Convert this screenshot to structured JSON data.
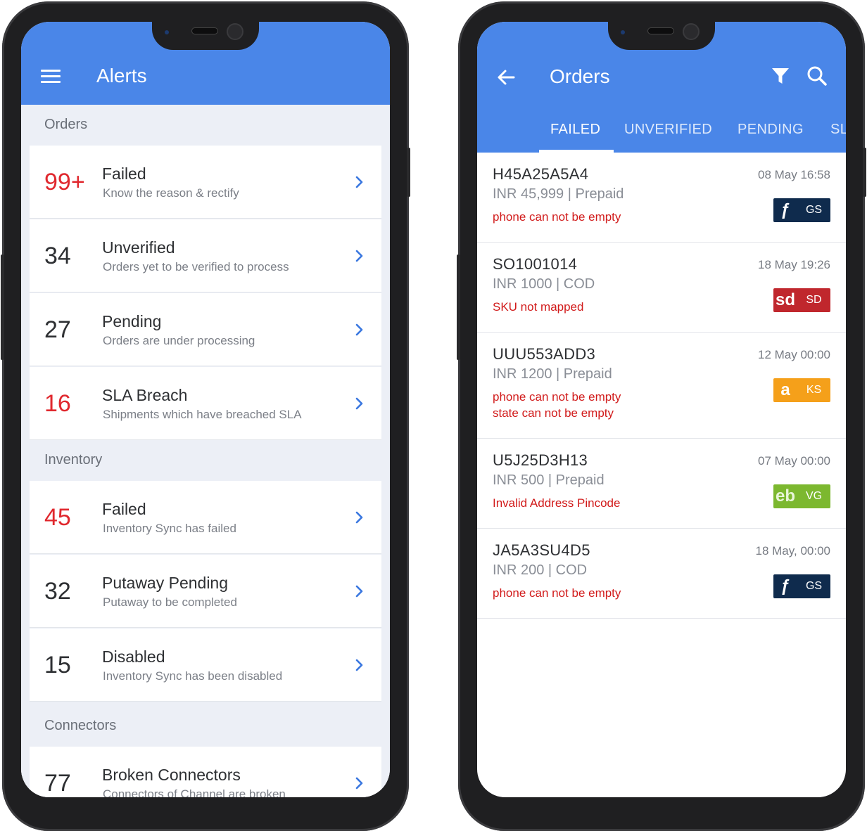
{
  "alerts_screen": {
    "title": "Alerts",
    "sections": [
      {
        "title": "Orders",
        "items": [
          {
            "count": "99+",
            "title": "Failed",
            "subtitle": "Know the reason & rectify",
            "highlight": true
          },
          {
            "count": "34",
            "title": "Unverified",
            "subtitle": "Orders yet to be verified to process",
            "highlight": false
          },
          {
            "count": "27",
            "title": "Pending",
            "subtitle": "Orders are under processing",
            "highlight": false
          },
          {
            "count": "16",
            "title": "SLA Breach",
            "subtitle": "Shipments which have breached SLA",
            "highlight": true
          }
        ]
      },
      {
        "title": "Inventory",
        "items": [
          {
            "count": "45",
            "title": "Failed",
            "subtitle": "Inventory Sync has failed",
            "highlight": true
          },
          {
            "count": "32",
            "title": "Putaway Pending",
            "subtitle": "Putaway to be completed",
            "highlight": false
          },
          {
            "count": "15",
            "title": "Disabled",
            "subtitle": "Inventory Sync has been disabled",
            "highlight": false
          }
        ]
      },
      {
        "title": "Connectors",
        "items": [
          {
            "count": "77",
            "title": "Broken Connectors",
            "subtitle": "Connectors of Channel are broken",
            "highlight": false
          }
        ]
      }
    ]
  },
  "orders_screen": {
    "title": "Orders",
    "tabs": [
      {
        "label": "FAILED",
        "active": true
      },
      {
        "label": "UNVERIFIED",
        "active": false
      },
      {
        "label": "PENDING",
        "active": false
      },
      {
        "label": "SL",
        "active": false
      }
    ],
    "orders": [
      {
        "id": "H45A25A5A4",
        "amount": "INR 45,999 | Prepaid",
        "errors": [
          "phone can not be empty"
        ],
        "time": "08 May 16:58",
        "channel": {
          "logo": "ƒ",
          "code": "GS",
          "color": "#0f2b4d"
        }
      },
      {
        "id": "SO1001014",
        "amount": "INR 1000 | COD",
        "errors": [
          "SKU not mapped"
        ],
        "time": "18 May 19:26",
        "channel": {
          "logo": "sd",
          "code": "SD",
          "color": "#c0272d"
        }
      },
      {
        "id": "UUU553ADD3",
        "amount": "INR 1200 | Prepaid",
        "errors": [
          "phone can not be empty",
          "state can not be empty"
        ],
        "time": "12 May 00:00",
        "channel": {
          "logo": "a",
          "code": "KS",
          "color": "#f5a01a"
        }
      },
      {
        "id": "U5J25D3H13",
        "amount": "INR 500 | Prepaid",
        "errors": [
          "Invalid Address Pincode"
        ],
        "time": "07 May 00:00",
        "channel": {
          "logo": "eb",
          "code": "VG",
          "color": "#7cb82f"
        }
      },
      {
        "id": "JA5A3SU4D5",
        "amount": "INR 200 | COD",
        "errors": [
          "phone can not be empty"
        ],
        "time": "18 May, 00:00",
        "channel": {
          "logo": "ƒ",
          "code": "GS",
          "color": "#0f2b4d"
        }
      }
    ]
  },
  "colors": {
    "primary": "#4a86e8",
    "error": "#d11a1a",
    "alert_red": "#e0282e"
  }
}
